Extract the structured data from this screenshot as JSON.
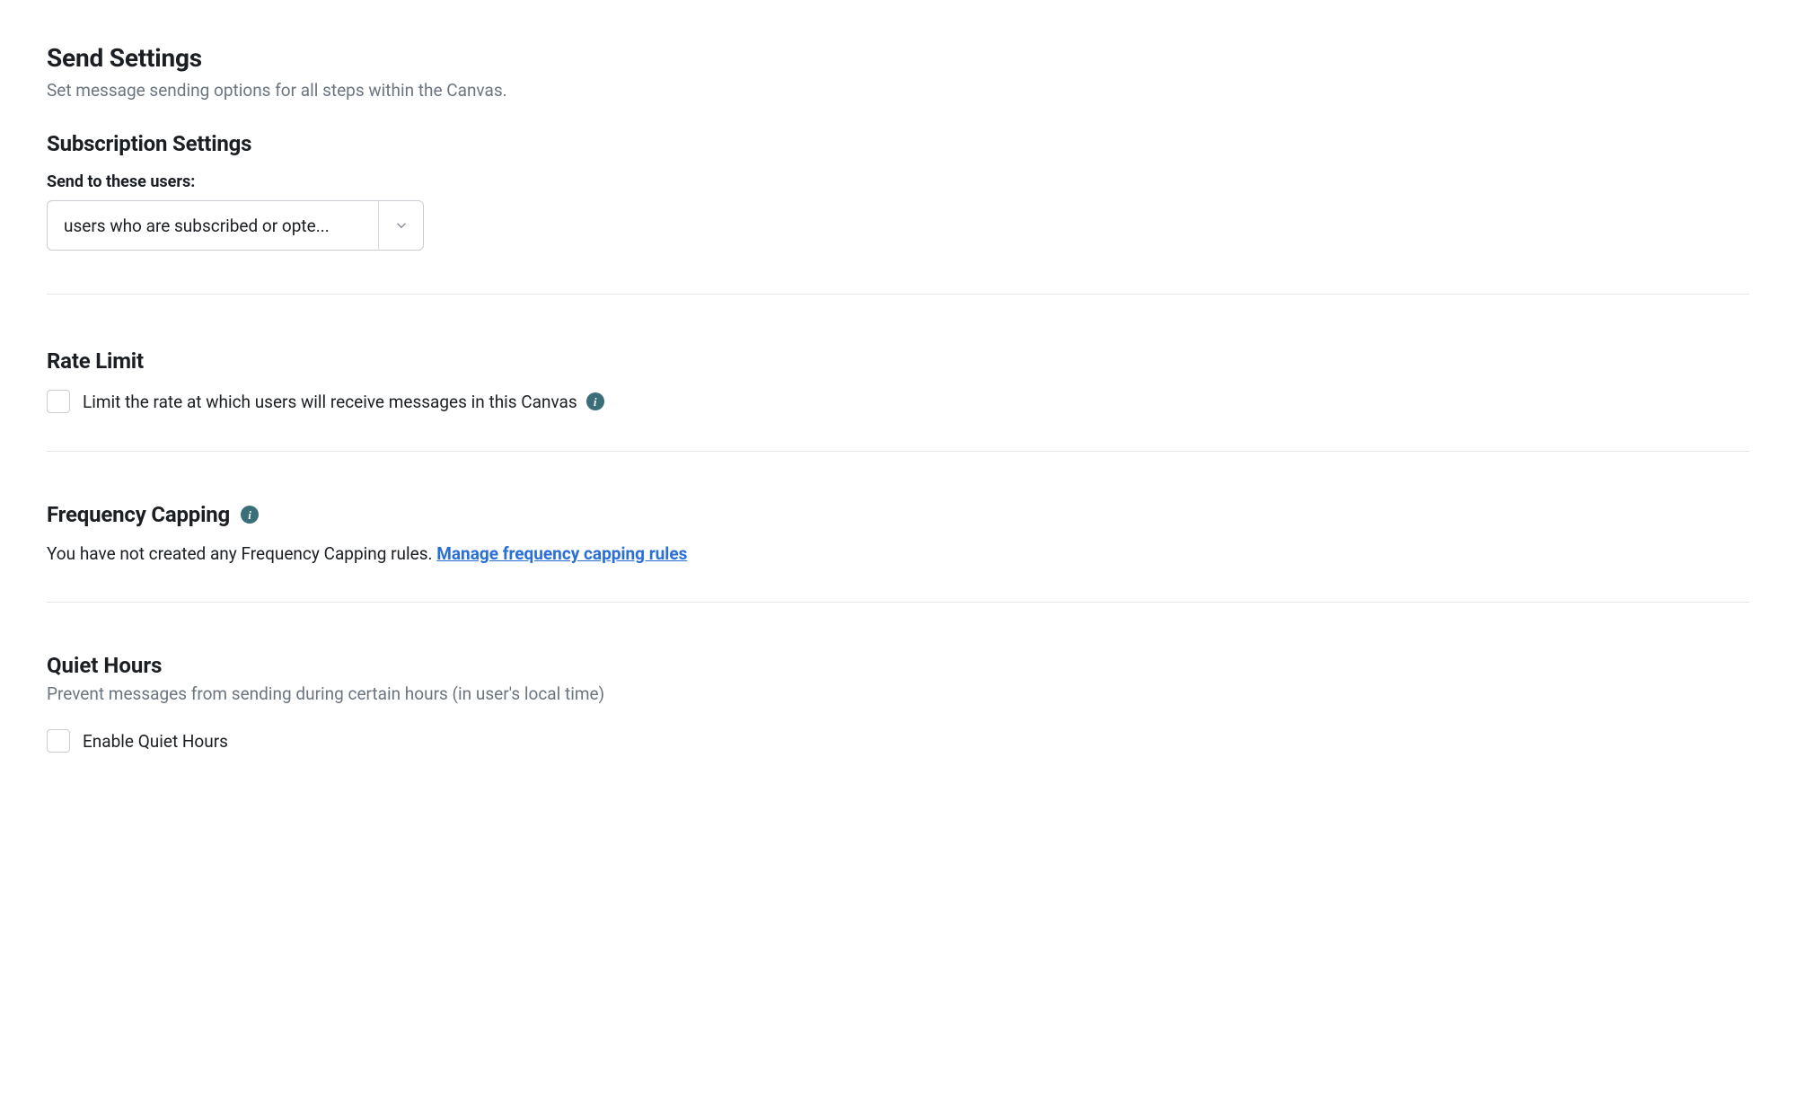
{
  "header": {
    "title": "Send Settings",
    "description": "Set message sending options for all steps within the Canvas."
  },
  "subscription": {
    "heading": "Subscription Settings",
    "field_label": "Send to these users:",
    "selected_value": "users who are subscribed or opte..."
  },
  "rate_limit": {
    "heading": "Rate Limit",
    "checkbox_label": "Limit the rate at which users will receive messages in this Canvas"
  },
  "frequency_capping": {
    "heading": "Frequency Capping",
    "body_text": "You have not created any Frequency Capping rules. ",
    "link_text": "Manage frequency capping rules"
  },
  "quiet_hours": {
    "heading": "Quiet Hours",
    "description": "Prevent messages from sending during certain hours (in user's local time)",
    "checkbox_label": "Enable Quiet Hours"
  }
}
